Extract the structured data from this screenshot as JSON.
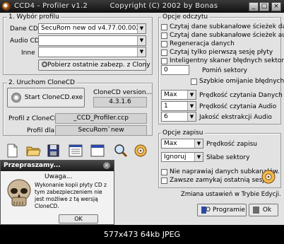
{
  "window": {
    "title": "CCD4 - Profiler v1.2",
    "copyright": "Copyright (C) 2002 by Bonas"
  },
  "group1": {
    "label": "1. Wybór profilu",
    "dane_cd_label": "Dane CD",
    "dane_cd_value": "SecuRom new od v4.77.00.0029",
    "audio_cd_label": "Audio CD",
    "audio_cd_value": "",
    "inne_label": "Inne",
    "inne_value": "",
    "fetch_button": "Pobierz ostatnie zabezp. z Clony"
  },
  "group2": {
    "label": "2. Uruchom CloneCD",
    "start_button": "Start CloneCD.exe",
    "version_label": "CloneCD version...",
    "version_value": "4.3.1.6",
    "profile_file_label": "Profil z CloneCD",
    "profile_file_value": "_CCD_Profiler.ccp",
    "profile_for_label": "Profil dla",
    "profile_for_value": "SecuRom`new"
  },
  "read_options": {
    "label": "Opcje odczytu",
    "checkboxes": [
      "Czytaj dane subkanałowe ścieżek danych",
      "Czytaj dane subkanałowe ścieżek audio",
      "Regeneracja danych",
      "Czytaj tylko pierwszą sesję płyty",
      "Inteligentny skaner błędnych sektorów"
    ],
    "skip_value": "0",
    "skip_label": "Pomiń sektory",
    "fast_skip_label": "Szybkie omijanie błędnych sektorów",
    "read_data_speed_value": "Max",
    "read_data_speed_label": "Prędkość czytania Danych",
    "read_audio_speed_value": "1",
    "read_audio_speed_label": "Prędkość czytania Audio",
    "audio_quality_value": "6",
    "audio_quality_label": "Jakość ekstrakcji Audio"
  },
  "write_options": {
    "label": "Opcje zapisu",
    "write_speed_value": "Max",
    "write_speed_label": "Prędkość zapisu",
    "bad_sectors_value": "Ignoruj",
    "bad_sectors_label": "Słabe sektory",
    "checkboxes": [
      "Nie naprawiaj danych subkanałów.",
      "Zawsze zamykaj ostatnią sesję"
    ]
  },
  "status_text": "Zmiana ustawień w Trybie Edycji.",
  "about_button": "O Programie",
  "ok_button": "Ok",
  "toolbar": {
    "icons": [
      "new-file-icon",
      "open-folder-icon",
      "save-disk-icon",
      "list-window-icon",
      "window-icon",
      "search-icon",
      "cd-icon"
    ]
  },
  "dialog": {
    "title": "Przepraszamy...",
    "heading": "Uwaga...",
    "message": "Wykonanie kopii płyty CD z tym zabezpieczeniem nie jest możliwe z tą wersją CloneCD.",
    "ok": "OK"
  },
  "caption": "577x473 64kb JPEG"
}
